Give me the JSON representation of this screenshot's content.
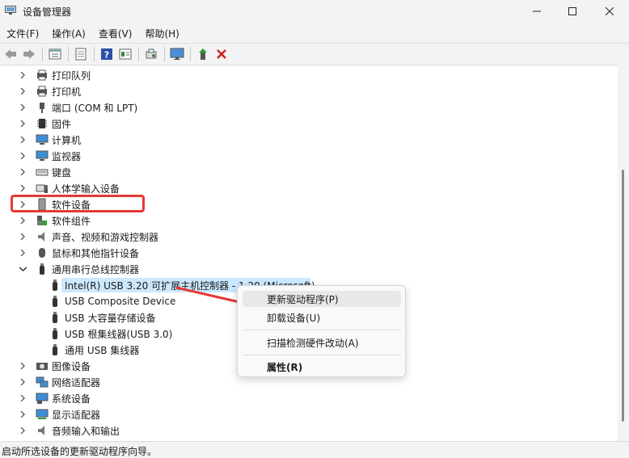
{
  "window": {
    "title": "设备管理器",
    "minimize_icon": "minimize-icon",
    "maximize_icon": "maximize-icon",
    "close_icon": "close-icon"
  },
  "menu": [
    "文件(F)",
    "操作(A)",
    "查看(V)",
    "帮助(H)"
  ],
  "toolbar": {
    "buttons": [
      "back-arrow-icon",
      "forward-arrow-icon",
      "properties-icon",
      "show-hidden-icon",
      "help-icon",
      "list-view-icon",
      "scan-hardware-icon",
      "monitor-icon",
      "update-driver-icon",
      "uninstall-x-icon"
    ]
  },
  "tree": {
    "categories": [
      {
        "label": "打印队列",
        "icon": "print-queue-icon"
      },
      {
        "label": "打印机",
        "icon": "printer-icon"
      },
      {
        "label": "端口 (COM 和 LPT)",
        "icon": "port-icon"
      },
      {
        "label": "固件",
        "icon": "firmware-icon"
      },
      {
        "label": "计算机",
        "icon": "computer-icon"
      },
      {
        "label": "监视器",
        "icon": "monitor-icon"
      },
      {
        "label": "键盘",
        "icon": "keyboard-icon"
      },
      {
        "label": "人体学输入设备",
        "icon": "hid-icon"
      },
      {
        "label": "软件设备",
        "icon": "software-device-icon"
      },
      {
        "label": "软件组件",
        "icon": "software-component-icon"
      },
      {
        "label": "声音、视频和游戏控制器",
        "icon": "speaker-icon"
      },
      {
        "label": "鼠标和其他指针设备",
        "icon": "mouse-icon"
      },
      {
        "label": "通用串行总线控制器",
        "icon": "usb-icon",
        "expanded": true
      }
    ],
    "usb_children": [
      {
        "label": "Intel(R) USB 3.20 可扩展主机控制器 - 1.20 (Microsoft)",
        "selected": true
      },
      {
        "label": "USB Composite Device"
      },
      {
        "label": "USB 大容量存储设备"
      },
      {
        "label": "USB 根集线器(USB 3.0)"
      },
      {
        "label": "通用 USB 集线器"
      }
    ],
    "categories_after": [
      {
        "label": "图像设备",
        "icon": "camera-icon"
      },
      {
        "label": "网络适配器",
        "icon": "network-icon"
      },
      {
        "label": "系统设备",
        "icon": "system-device-icon"
      },
      {
        "label": "显示适配器",
        "icon": "display-adapter-icon"
      },
      {
        "label": "音频输入和输出",
        "icon": "audio-icon"
      }
    ]
  },
  "context_menu": {
    "items": [
      {
        "label": "更新驱动程序(P)",
        "hover": true
      },
      {
        "label": "卸载设备(U)"
      },
      {
        "label": "扫描检测硬件改动(A)"
      },
      {
        "label": "属性(R)",
        "bold": true
      }
    ]
  },
  "status": "启动所选设备的更新驱动程序向导。",
  "colors": {
    "annotation": "#e53935",
    "selection": "#cce8ff",
    "background": "#f3f3f3"
  }
}
